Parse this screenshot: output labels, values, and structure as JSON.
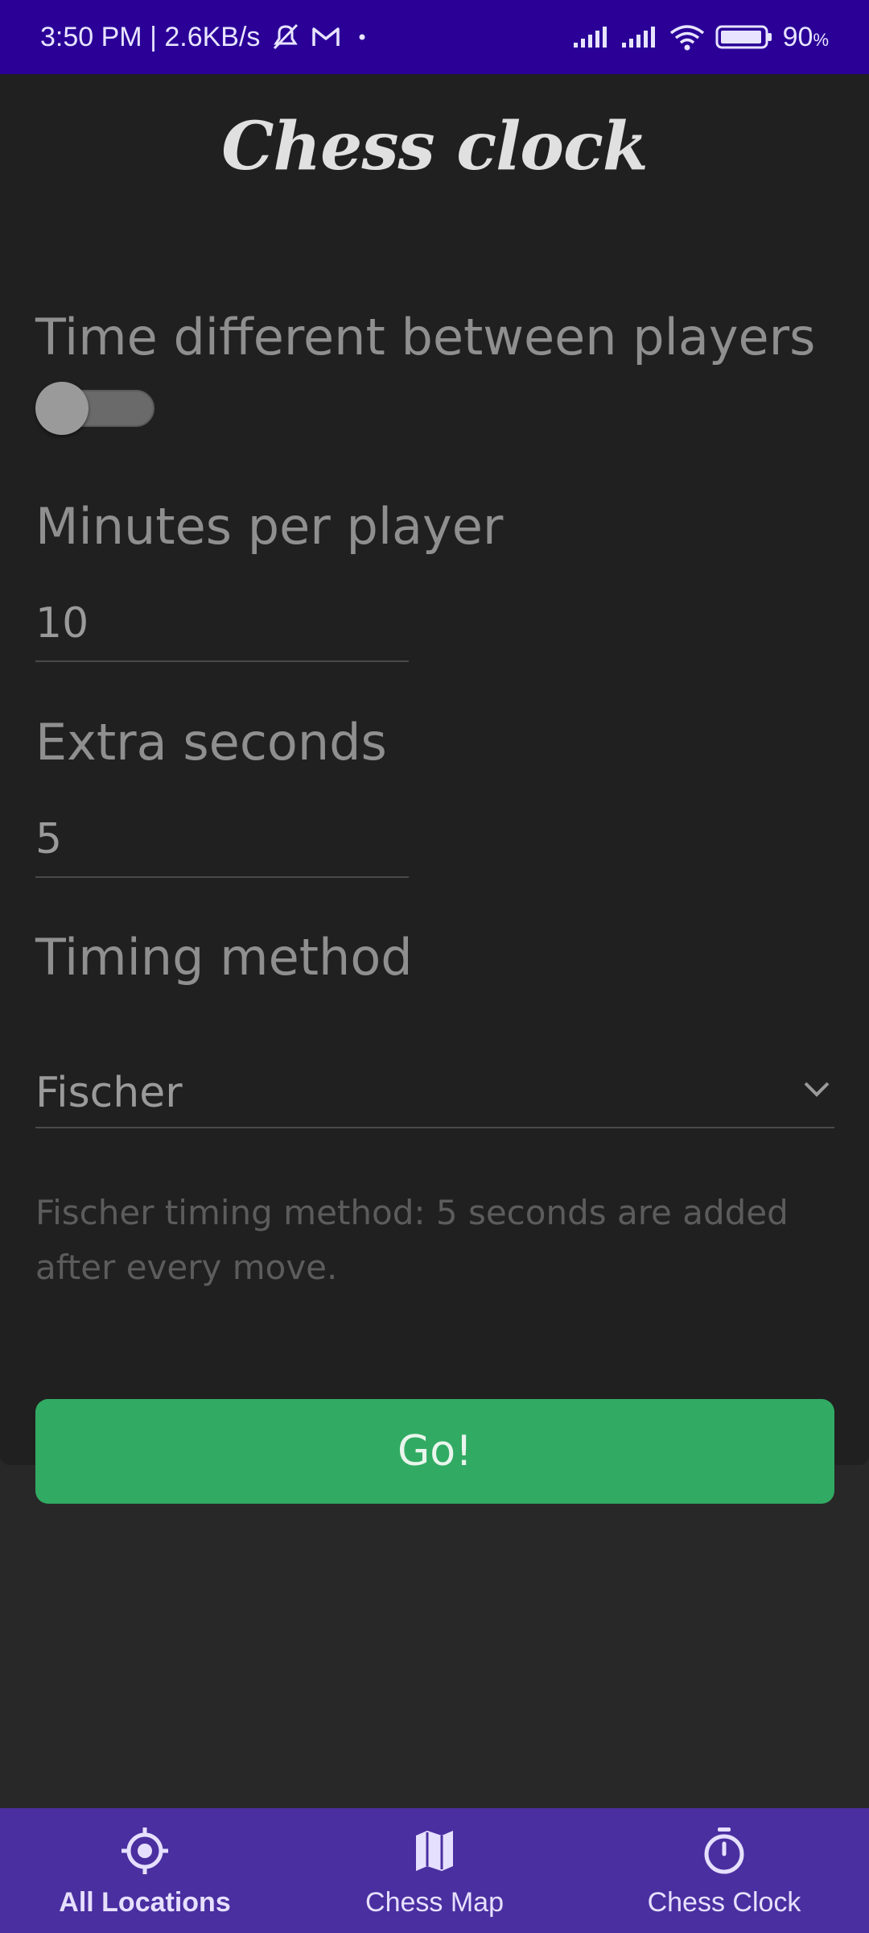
{
  "status_bar": {
    "time": "3:50 PM | 2.6KB/s",
    "battery_level": "90",
    "battery_unit": "%",
    "icons": [
      "dnd-off-icon",
      "gmail-icon",
      "dot-icon",
      "signal-icon",
      "signal-icon",
      "wifi-icon",
      "battery-icon"
    ]
  },
  "app": {
    "title": "Chess clock"
  },
  "form": {
    "time_diff_label": "Time different between players",
    "time_diff_enabled": false,
    "minutes_label": "Minutes per player",
    "minutes_value": "10",
    "extra_seconds_label": "Extra seconds",
    "extra_seconds_value": "5",
    "timing_label": "Timing method",
    "timing_value": "Fischer",
    "helper_text": "Fischer timing method: 5 seconds are added after every move.",
    "go_label": "Go!"
  },
  "bottom_nav": {
    "items": [
      {
        "label": "All Locations",
        "icon": "crosshair-icon",
        "active": true
      },
      {
        "label": "Chess Map",
        "icon": "map-icon",
        "active": false
      },
      {
        "label": "Chess Clock",
        "icon": "stopwatch-icon",
        "active": false
      }
    ]
  },
  "colors": {
    "status_bar": "#2a0097",
    "nav_bar": "#4a2fa0",
    "go_button": "#31ab63",
    "card": "#202020",
    "background": "#282828"
  }
}
